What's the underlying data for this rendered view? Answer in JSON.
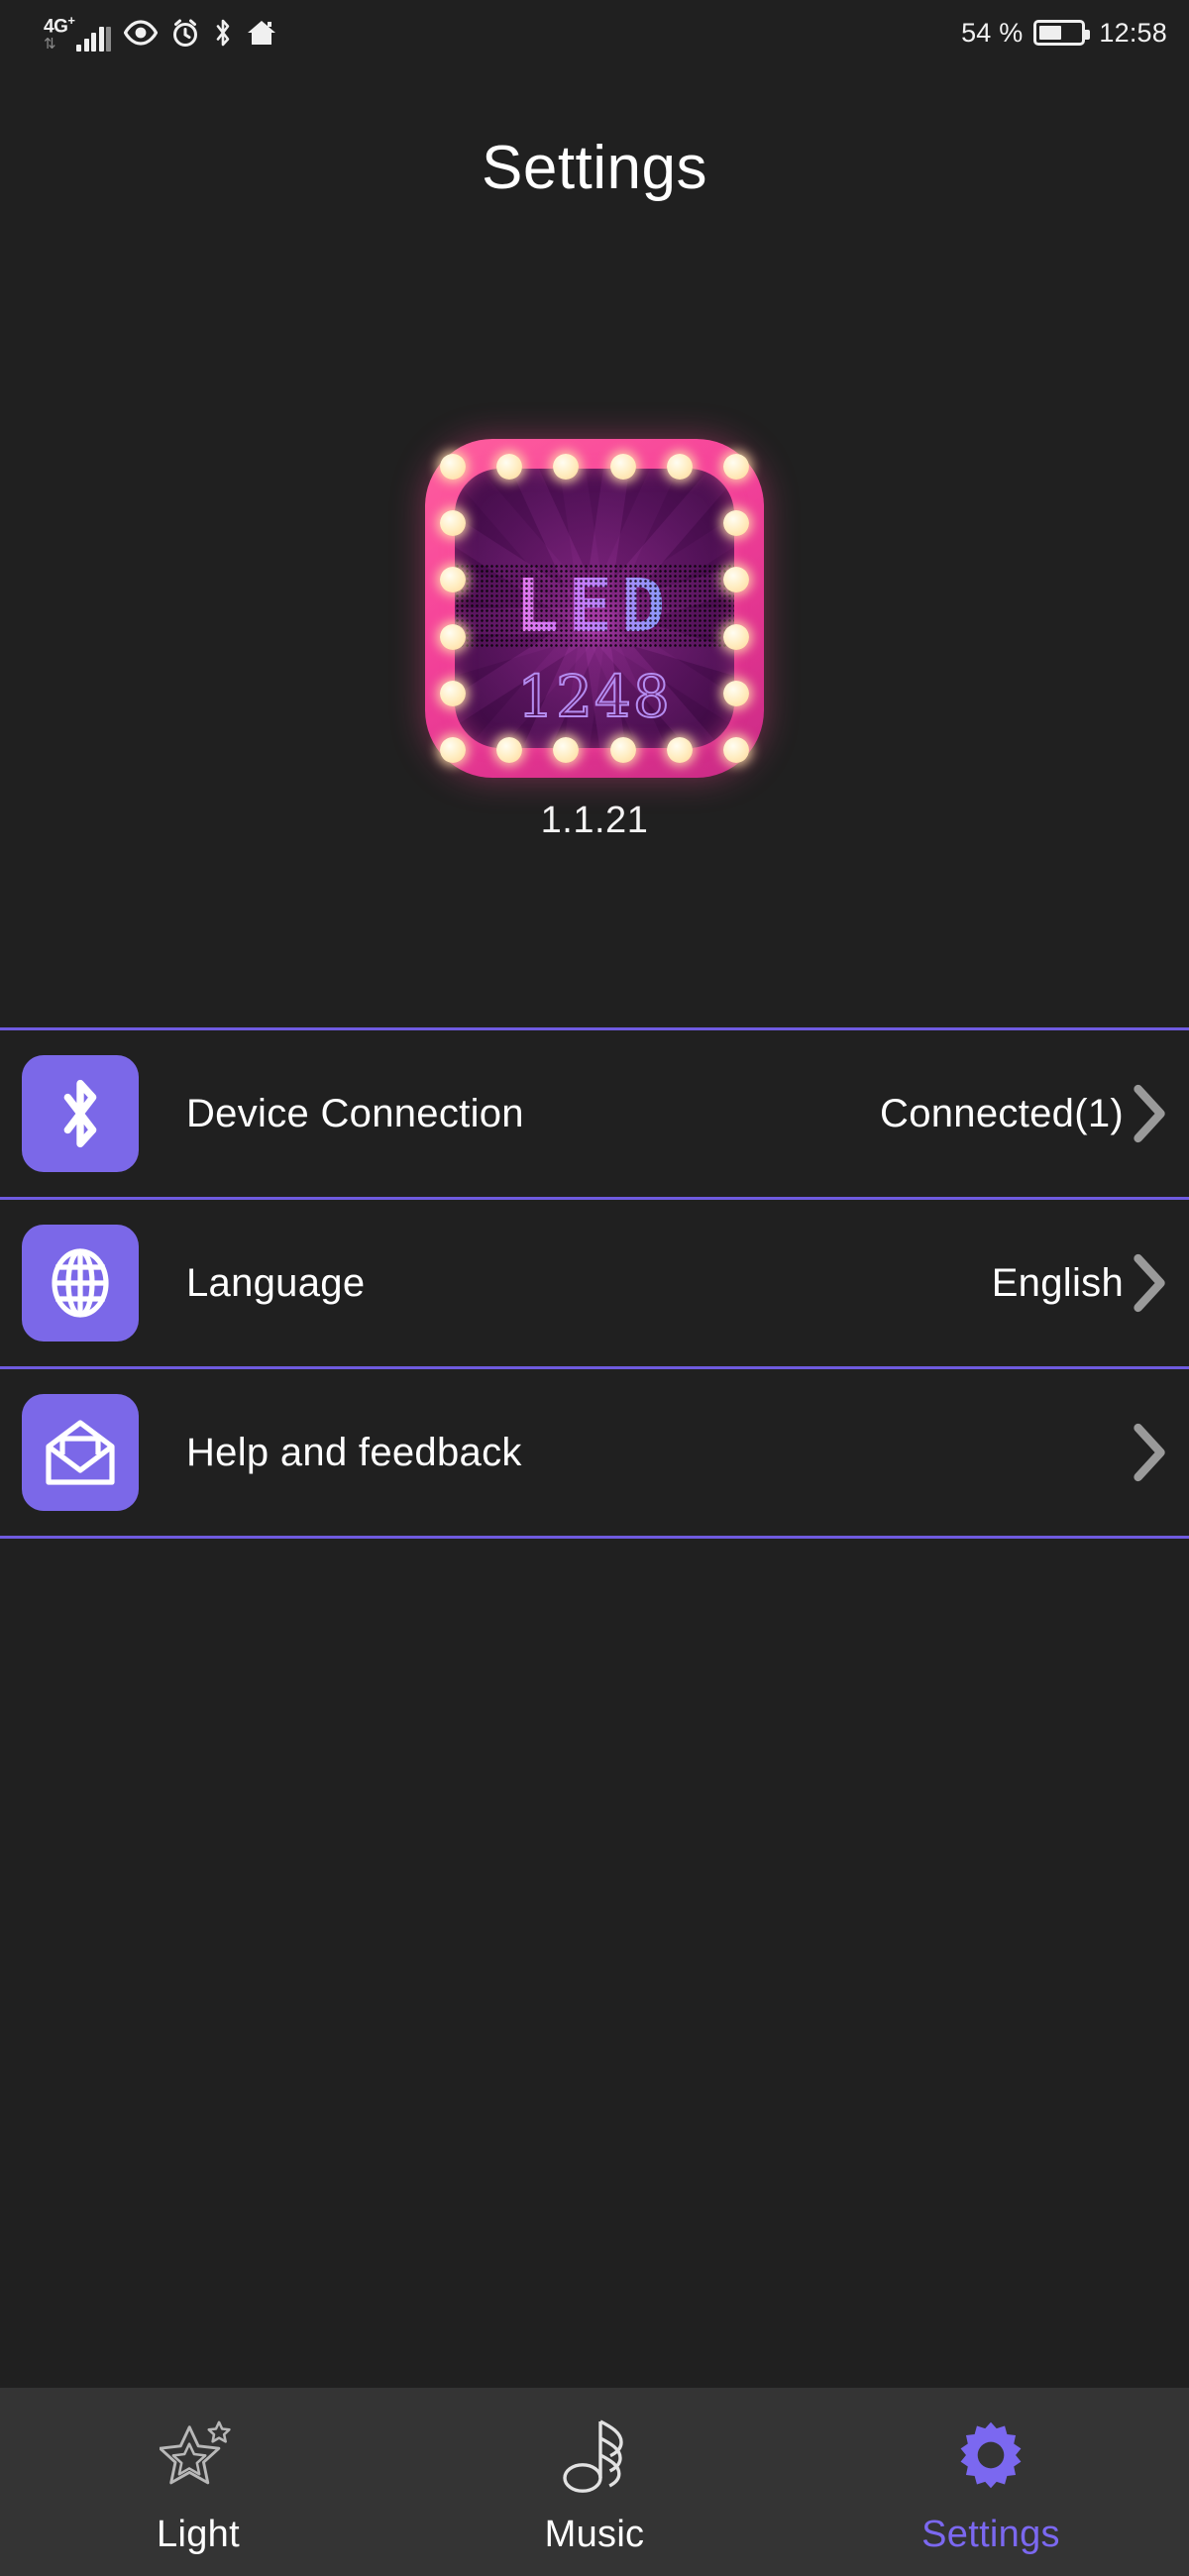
{
  "status_bar": {
    "network_generation": "4G",
    "network_superscript": "+",
    "data_arrows_icon": "data-transfer-icon",
    "signal_icon": "signal-bars-icon",
    "eye_icon": "eye-icon",
    "alarm_icon": "alarm-clock-icon",
    "bluetooth_icon": "bluetooth-icon",
    "home_icon": "home-icon",
    "battery_percent": "54 %",
    "battery_level": 54,
    "battery_icon": "battery-icon",
    "time": "12:58"
  },
  "header": {
    "title": "Settings"
  },
  "app_info": {
    "logo_icon": "led-marquee-app-logo",
    "logo_text": "LED",
    "logo_number": "1248",
    "version": "1.1.21"
  },
  "settings_rows": [
    {
      "icon": "bluetooth-icon",
      "label": "Device Connection",
      "value": "Connected(1)",
      "chevron": "chevron-right-icon"
    },
    {
      "icon": "globe-icon",
      "label": "Language",
      "value": "English",
      "chevron": "chevron-right-icon"
    },
    {
      "icon": "envelope-icon",
      "label": "Help and feedback",
      "value": "",
      "chevron": "chevron-right-icon"
    }
  ],
  "bottom_nav": {
    "items": [
      {
        "icon": "stars-icon",
        "label": "Light",
        "active": false
      },
      {
        "icon": "music-note-icon",
        "label": "Music",
        "active": false
      },
      {
        "icon": "gear-icon",
        "label": "Settings",
        "active": true
      }
    ]
  },
  "colors": {
    "background": "#202020",
    "navbar_background": "#343434",
    "accent_purple": "#7b68e8",
    "divider_purple": "#6f5be0",
    "active_tab": "#7b68f0",
    "chevron_gray": "#9a9a9a"
  }
}
